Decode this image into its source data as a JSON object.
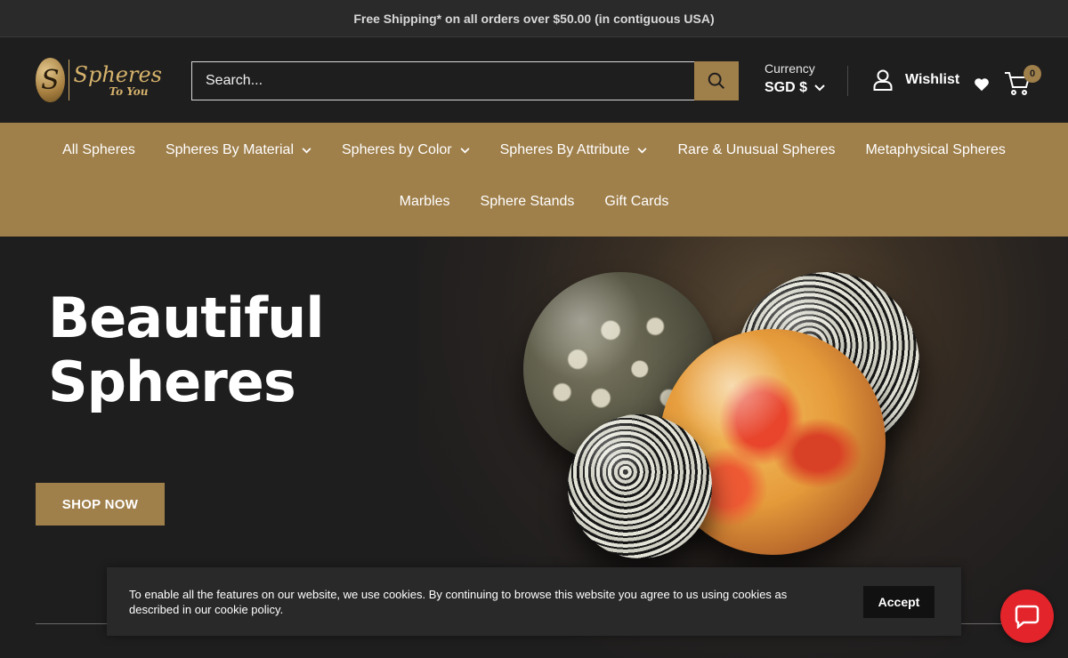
{
  "announcement": {
    "text": "Free Shipping* on all orders over $50.00 (in contiguous USA)"
  },
  "header": {
    "logo": {
      "initial": "S",
      "line1": "Spheres",
      "line2": "To You"
    },
    "search": {
      "placeholder": "Search..."
    },
    "currency": {
      "label": "Currency",
      "value": "SGD $"
    },
    "account": {
      "wishlist_label": "Wishlist"
    },
    "cart": {
      "count": "0"
    }
  },
  "nav": {
    "row1": [
      "All Spheres",
      "Spheres By Material",
      "Spheres by Color",
      "Spheres By Attribute",
      "Rare & Unusual Spheres",
      "Metaphysical Spheres"
    ],
    "row2": [
      "Marbles",
      "Sphere Stands",
      "Gift Cards"
    ]
  },
  "hero": {
    "title_line1": "Beautiful",
    "title_line2": "Spheres",
    "cta": "SHOP NOW"
  },
  "cookie": {
    "text": "To enable all the features on our website, we use cookies. By continuing to browse this website you agree to us using cookies as described in our cookie policy.",
    "accept": "Accept"
  },
  "colors": {
    "accent": "#9f7f4a",
    "background": "#1f1e1e",
    "chat": "#e3242b"
  }
}
